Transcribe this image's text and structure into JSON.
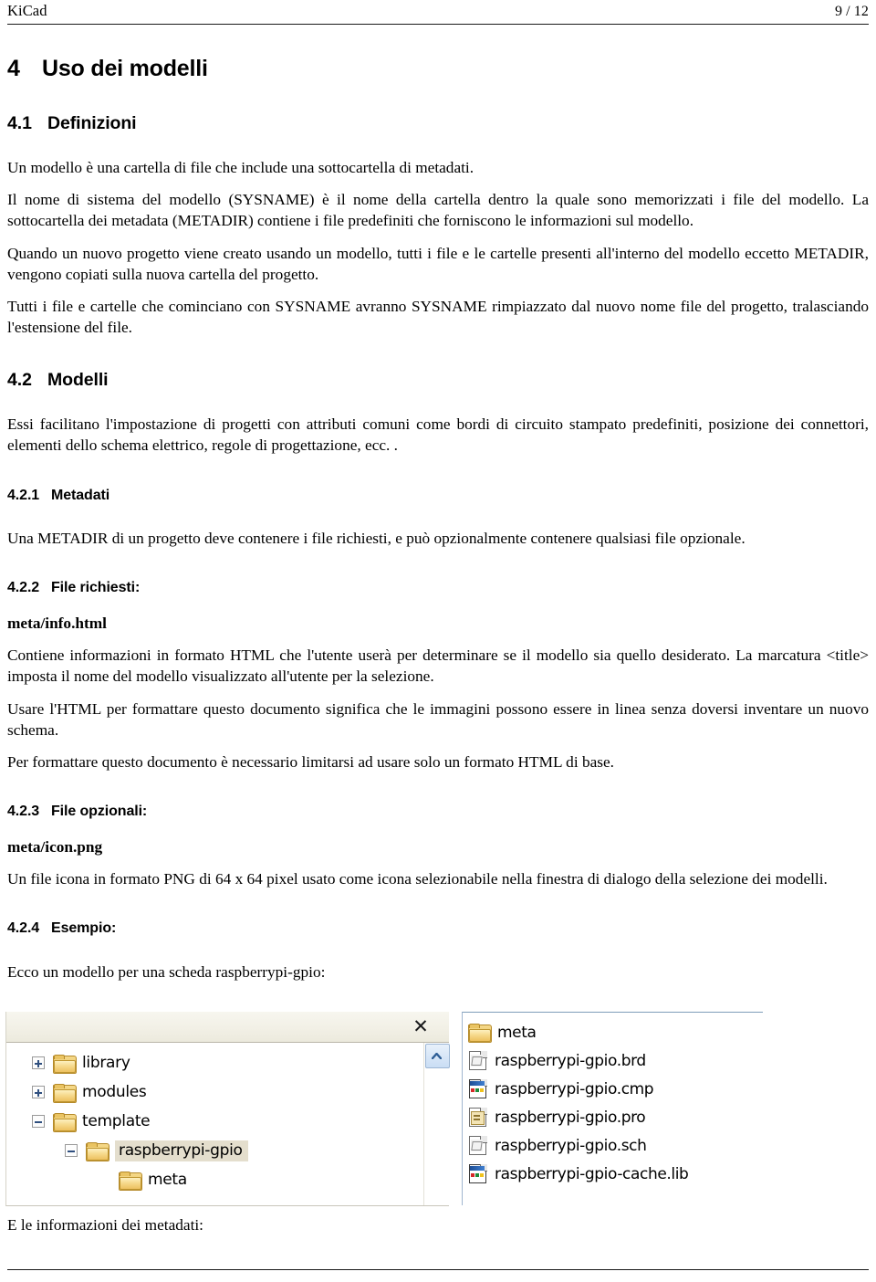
{
  "header": {
    "title": "KiCad",
    "page_indicator": "9 / 12"
  },
  "sections": {
    "s4": {
      "num": "4",
      "title": "Uso dei modelli"
    },
    "s41": {
      "num": "4.1",
      "title": "Definizioni"
    },
    "s42": {
      "num": "4.2",
      "title": "Modelli"
    },
    "s421": {
      "num": "4.2.1",
      "title": "Metadati"
    },
    "s422": {
      "num": "4.2.2",
      "title": "File richiesti:"
    },
    "s423": {
      "num": "4.2.3",
      "title": "File opzionali:"
    },
    "s424": {
      "num": "4.2.4",
      "title": "Esempio:"
    }
  },
  "paragraphs": {
    "p1": "Un modello è una cartella di file che include una sottocartella di metadati.",
    "p2": "Il nome di sistema del modello (SYSNAME) è il nome della cartella dentro la quale sono memorizzati i file del modello. La sottocartella dei metadata (METADIR) contiene i file predefiniti che forniscono le informazioni sul modello.",
    "p3": "Quando un nuovo progetto viene creato usando un modello, tutti i file e le cartelle presenti all'interno del modello eccetto METADIR, vengono copiati sulla nuova cartella del progetto.",
    "p4": "Tutti i file e cartelle che cominciano con SYSNAME avranno SYSNAME rimpiazzato dal nuovo nome file del progetto, tralasciando l'estensione del file.",
    "p5": "Essi facilitano l'impostazione di progetti con attributi comuni come bordi di circuito stampato predefiniti, posizione dei connettori, elementi dello schema elettrico, regole di progettazione, ecc. .",
    "p6": "Una METADIR di un progetto deve contenere i file richiesti, e può opzionalmente contenere qualsiasi file opzionale.",
    "file_info_html": "meta/info.html",
    "p7": "Contiene informazioni in formato HTML che l'utente userà per determinare se il modello sia quello desiderato. La marcatura <title> imposta il nome del modello visualizzato all'utente per la selezione.",
    "p8": "Usare l'HTML per formattare questo documento significa che le immagini possono essere in linea senza doversi inventare un nuovo schema.",
    "p9": "Per formattare questo documento è necessario limitarsi ad usare solo un formato HTML di base.",
    "file_icon_png": "meta/icon.png",
    "p10": "Un file icona in formato PNG di 64 x 64 pixel usato come icona selezionabile nella finestra di dialogo della selezione dei modelli.",
    "p11": "Ecco un modello per una scheda raspberrypi-gpio:",
    "p12": "E le informazioni dei metadati:"
  },
  "explorer": {
    "close_label": "✕",
    "scroll_up_label": "scroll-up",
    "tree": [
      {
        "label": "library",
        "level": 1,
        "expander": "plus",
        "selected": false
      },
      {
        "label": "modules",
        "level": 1,
        "expander": "plus",
        "selected": false
      },
      {
        "label": "template",
        "level": 1,
        "expander": "minus",
        "selected": false
      },
      {
        "label": "raspberrypi-gpio",
        "level": 2,
        "expander": "minus",
        "selected": true
      },
      {
        "label": "meta",
        "level": 3,
        "expander": "none",
        "selected": false
      }
    ],
    "files": [
      {
        "label": "meta",
        "icon": "folder"
      },
      {
        "label": "raspberrypi-gpio.brd",
        "icon": "sketch"
      },
      {
        "label": "raspberrypi-gpio.cmp",
        "icon": "win"
      },
      {
        "label": "raspberrypi-gpio.pro",
        "icon": "pro"
      },
      {
        "label": "raspberrypi-gpio.sch",
        "icon": "sketch"
      },
      {
        "label": "raspberrypi-gpio-cache.lib",
        "icon": "win"
      }
    ]
  },
  "colors": {
    "folder": "#EDC160",
    "selection": "#E4DECD",
    "accent_blue": "#3F7FD0"
  }
}
